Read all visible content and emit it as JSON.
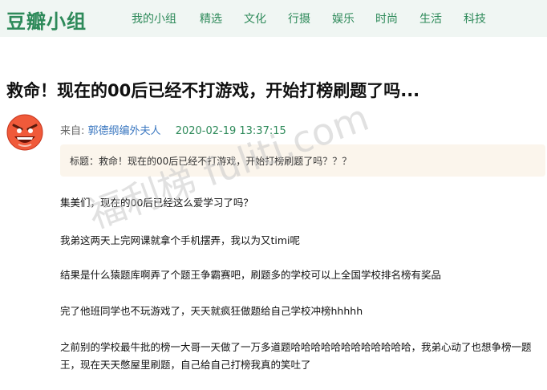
{
  "header": {
    "logo": "豆瓣小组",
    "nav": [
      "我的小组",
      "精选",
      "文化",
      "行摄",
      "娱乐",
      "时尚",
      "生活",
      "科技"
    ]
  },
  "post": {
    "title": "救命！现在的00后已经不打游戏，开始打榜刷题了吗...",
    "from_label": "来自:",
    "author": "郭德纲编外夫人",
    "timestamp": "2020-02-19 13:37:15",
    "quote": "标题：救命！现在的00后已经不打游戏，开始打榜刷题了吗？？？",
    "paragraphs": [
      "集美们，现在的00后已经这么爱学习了吗？",
      "我弟这两天上完网课就拿个手机摆弄，我以为又timi呢",
      "结果是什么猿题库啊弄了个题王争霸赛吧，刷题多的学校可以上全国学校排名榜有奖品",
      "完了他班同学也不玩游戏了，天天就疯狂做题给自己学校冲榜hhhhh",
      "之前别的学校最牛批的榜一大哥一天做了一万多道题哈哈哈哈哈哈哈哈哈哈哈哈，我弟心动了也想争榜一题王，现在天天憋屋里刷题，自己给自己打榜我真的笑吐了"
    ]
  },
  "watermark": "福利梯 fuliti.com",
  "colors": {
    "brand": "#2e8a5a",
    "link": "#3a77c0",
    "quote_bg": "#fbf5ec"
  }
}
